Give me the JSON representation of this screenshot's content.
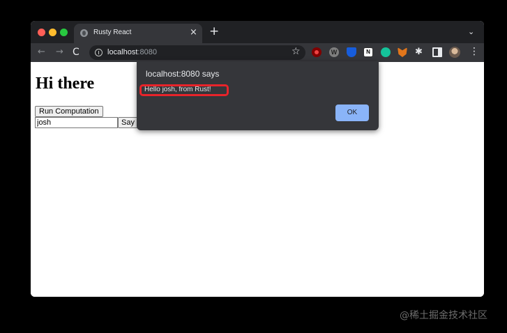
{
  "browser": {
    "tab_title": "Rusty React",
    "tab_close": "×",
    "new_tab": "+",
    "url_host": "localhost",
    "url_port": ":8080"
  },
  "page": {
    "heading": "Hi there",
    "run_button": "Run Computation",
    "name_input_value": "josh",
    "say_button": "Say"
  },
  "dialog": {
    "title": "localhost:8080 says",
    "message": "Hello josh, from Rust!",
    "ok_button": "OK",
    "highlight_color": "#e8242a"
  },
  "watermark": "@稀土掘金技术社区"
}
